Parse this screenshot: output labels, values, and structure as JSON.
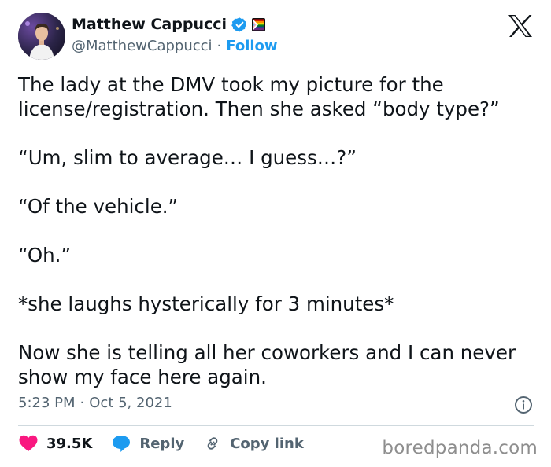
{
  "author": {
    "name": "Matthew Cappucci",
    "handle": "@MatthewCappucci",
    "separator": "·",
    "follow_label": "Follow"
  },
  "icons": {
    "verified": "verified-badge-icon",
    "flag": "flag-icon",
    "brand": "x-logo-icon",
    "info": "info-icon",
    "like": "heart-icon",
    "reply": "speech-bubble-icon",
    "copy": "link-icon"
  },
  "colors": {
    "accent": "#1d9bf0",
    "like": "#f91880",
    "text": "#0f1419",
    "muted": "#536471"
  },
  "tweet": {
    "paragraphs": [
      "The lady at the DMV took my picture for the license/registration. Then she asked “body type?”",
      "“Um, slim to average… I guess…?”",
      "“Of the vehicle.”",
      "“Oh.”",
      "*she laughs hysterically for 3 minutes*",
      "Now she is telling all her coworkers and I can never show my face here again."
    ],
    "time": "5:23 PM",
    "date": "Oct 5, 2021"
  },
  "actions": {
    "likes": "39.5K",
    "reply_label": "Reply",
    "copy_label": "Copy link"
  },
  "watermark": "boredpanda.com"
}
